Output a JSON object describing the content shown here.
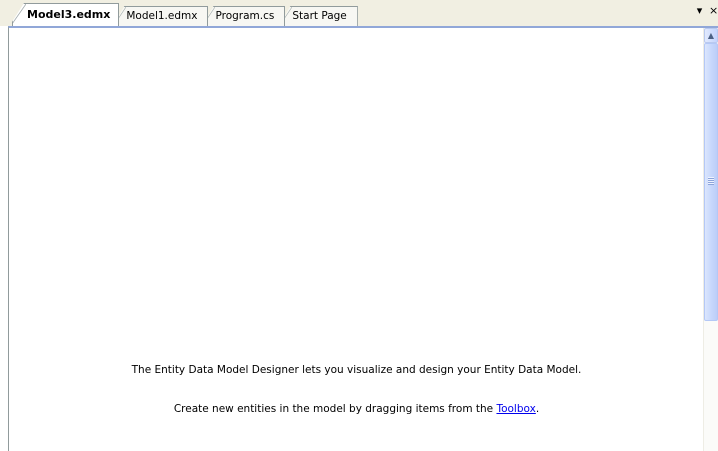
{
  "tabs": [
    {
      "label": "Model3.edmx",
      "active": true
    },
    {
      "label": "Model1.edmx",
      "active": false
    },
    {
      "label": "Program.cs",
      "active": false
    },
    {
      "label": "Start Page",
      "active": false
    }
  ],
  "tabstrip_controls": {
    "dropdown_glyph": "▾",
    "close_glyph": "×"
  },
  "designer": {
    "message_line1": "The Entity Data Model Designer lets you visualize and design your Entity Data Model.",
    "message_line2_prefix": "Create new entities in the model by dragging items from the ",
    "toolbox_link": "Toolbox",
    "message_line2_suffix": "."
  },
  "scrollbar": {
    "up_glyph": "▲"
  },
  "colors": {
    "tabstrip_bg": "#f1efe2",
    "accent_border": "#91a7d8",
    "link": "#0000ee"
  },
  "icons": {
    "dropdown": "chevron-down-icon",
    "close": "close-icon",
    "scroll_up": "scroll-up-arrow-icon"
  }
}
